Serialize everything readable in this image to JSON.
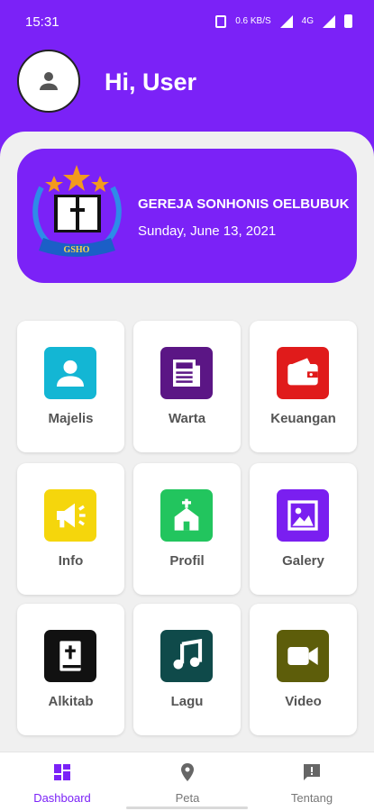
{
  "status": {
    "time": "15:31",
    "net1": "0.6\nKB/S",
    "net2": "4G"
  },
  "header": {
    "greeting": "Hi, User"
  },
  "banner": {
    "church_name": "GEREJA SONHONIS OELBUBUK",
    "date": "Sunday, June 13, 2021",
    "logo_text": "GSHO"
  },
  "menu": [
    {
      "label": "Majelis",
      "icon": "person-icon",
      "color": "#13b6d4"
    },
    {
      "label": "Warta",
      "icon": "newspaper-icon",
      "color": "#5b1685"
    },
    {
      "label": "Keuangan",
      "icon": "wallet-icon",
      "color": "#e01b1b"
    },
    {
      "label": "Info",
      "icon": "megaphone-icon",
      "color": "#f5d60c"
    },
    {
      "label": "Profil",
      "icon": "church-icon",
      "color": "#22c55e"
    },
    {
      "label": "Galery",
      "icon": "image-icon",
      "color": "#7a1ff0"
    },
    {
      "label": "Alkitab",
      "icon": "bible-icon",
      "color": "#111111"
    },
    {
      "label": "Lagu",
      "icon": "music-note-icon",
      "color": "#0f4a4a"
    },
    {
      "label": "Video",
      "icon": "video-camera-icon",
      "color": "#5d5d0a"
    }
  ],
  "nav": [
    {
      "label": "Dashboard",
      "icon": "dashboard-icon"
    },
    {
      "label": "Peta",
      "icon": "map-pin-icon"
    },
    {
      "label": "Tentang",
      "icon": "feedback-icon"
    }
  ],
  "colors": {
    "brand": "#7b22f7",
    "background": "#f0f0f0"
  }
}
